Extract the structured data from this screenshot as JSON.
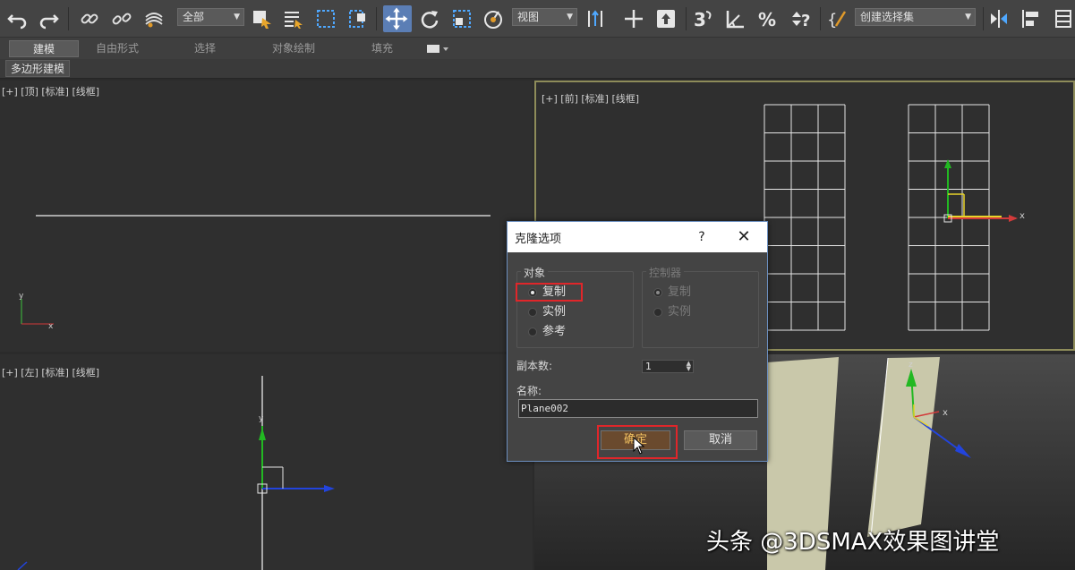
{
  "toolbar": {
    "selection_filter": "全部",
    "reference_coord": "视图",
    "named_selection": "创建选择集"
  },
  "ribbon": {
    "tabs": [
      "建模",
      "自由形式",
      "选择",
      "对象绘制",
      "填充"
    ],
    "sub_tab": "多边形建模"
  },
  "viewports": {
    "top": "[+] [顶] [标准] [线框]",
    "front": "[+] [前] [标准] [线框]",
    "left": "[+] [左] [标准] [线框]"
  },
  "dialog": {
    "title": "克隆选项",
    "help": "?",
    "close": "✕",
    "object_group": "对象",
    "object_options": [
      "复制",
      "实例",
      "参考"
    ],
    "object_selected": 0,
    "controller_group": "控制器",
    "controller_options": [
      "复制",
      "实例"
    ],
    "copies_label": "副本数:",
    "copies_value": "1",
    "name_label": "名称:",
    "name_value": "Plane002",
    "ok": "确定",
    "cancel": "取消"
  },
  "watermark": "头条 @3DSMAX效果图讲堂",
  "colors": {
    "toolbar_bg": "#444444",
    "viewport_bg": "#2f2f2f",
    "active_viewport_border": "#8e8c5a",
    "highlight_red": "#e0262a",
    "plane_color": "#c9c8aa"
  }
}
